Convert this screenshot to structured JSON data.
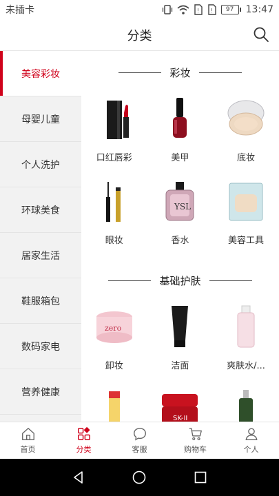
{
  "status": {
    "carrier": "未插卡",
    "battery": "97",
    "time": "13:47"
  },
  "header": {
    "title": "分类"
  },
  "sidebar": {
    "items": [
      {
        "label": "美容彩妆",
        "active": true
      },
      {
        "label": "母婴儿童"
      },
      {
        "label": "个人洗护"
      },
      {
        "label": "环球美食"
      },
      {
        "label": "居家生活"
      },
      {
        "label": "鞋服箱包"
      },
      {
        "label": "数码家电"
      },
      {
        "label": "营养健康"
      }
    ]
  },
  "sections": [
    {
      "title": "彩妆",
      "items": [
        {
          "label": "口红唇彩",
          "icon": "lipstick-icon"
        },
        {
          "label": "美甲",
          "icon": "nail-polish-icon"
        },
        {
          "label": "底妆",
          "icon": "cushion-compact-icon"
        },
        {
          "label": "眼妆",
          "icon": "eyeliner-icon"
        },
        {
          "label": "香水",
          "icon": "perfume-icon"
        },
        {
          "label": "美容工具",
          "icon": "makeup-sponge-icon"
        }
      ]
    },
    {
      "title": "基础护肤",
      "items": [
        {
          "label": "卸妆",
          "icon": "cleansing-balm-icon"
        },
        {
          "label": "洁面",
          "icon": "facial-cleanser-icon"
        },
        {
          "label": "爽肤水/...",
          "icon": "toner-icon"
        },
        {
          "label": "",
          "icon": "serum-bottle-icon"
        },
        {
          "label": "",
          "icon": "cream-jar-icon"
        },
        {
          "label": "",
          "icon": "essence-bottle-icon"
        }
      ]
    }
  ],
  "tabbar": {
    "items": [
      {
        "label": "首页",
        "icon": "home-icon"
      },
      {
        "label": "分类",
        "icon": "category-icon",
        "active": true
      },
      {
        "label": "客服",
        "icon": "chat-icon"
      },
      {
        "label": "购物车",
        "icon": "cart-icon"
      },
      {
        "label": "个人",
        "icon": "profile-icon"
      }
    ]
  },
  "colors": {
    "accent": "#d0021b",
    "sidebar_bg": "#f2f2f2"
  }
}
